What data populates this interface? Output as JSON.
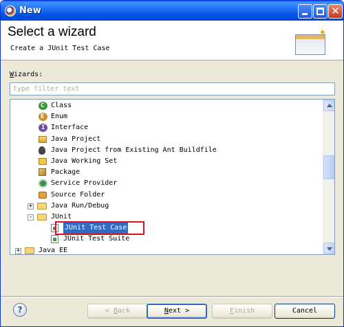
{
  "window": {
    "title": "New"
  },
  "header": {
    "title": "Select a wizard",
    "subtitle": "Create a JUnit Test Case"
  },
  "wizards": {
    "label_mnemonic": "W",
    "label_rest": "izards:",
    "filter_placeholder": "type filter text"
  },
  "tree": {
    "items": [
      {
        "label": "Class",
        "icon": "class-icon"
      },
      {
        "label": "Enum",
        "icon": "enum-icon"
      },
      {
        "label": "Interface",
        "icon": "interface-icon"
      },
      {
        "label": "Java Project",
        "icon": "java-project-icon"
      },
      {
        "label": "Java Project from Existing Ant Buildfile",
        "icon": "ant-icon"
      },
      {
        "label": "Java Working Set",
        "icon": "working-set-icon"
      },
      {
        "label": "Package",
        "icon": "package-icon"
      },
      {
        "label": "Service Provider",
        "icon": "service-provider-icon"
      },
      {
        "label": "Source Folder",
        "icon": "source-folder-icon"
      },
      {
        "label": "Java Run/Debug",
        "icon": "folder-icon",
        "expander": "+"
      },
      {
        "label": "JUnit",
        "icon": "folder-open-icon",
        "expander": "-"
      },
      {
        "label": "JUnit Test Case",
        "icon": "junit-test-case-icon",
        "selected": true
      },
      {
        "label": "JUnit Test Suite",
        "icon": "junit-test-suite-icon"
      },
      {
        "label": "Java EE",
        "icon": "folder-icon",
        "expander": "+"
      }
    ]
  },
  "buttons": {
    "help": "?",
    "back_mn": "B",
    "back_rest": "ack",
    "back_prefix": "< ",
    "next_mn": "N",
    "next_rest": "ext >",
    "finish_mn": "F",
    "finish_rest": "inish",
    "cancel": "Cancel"
  }
}
